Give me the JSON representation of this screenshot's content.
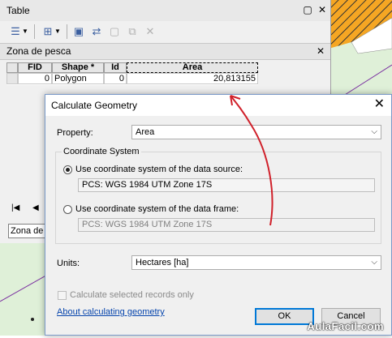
{
  "table_window": {
    "title": "Table",
    "min_glyph": "▢",
    "close_glyph": "✕",
    "layer_tab": "Zona de pesca",
    "layer_close_glyph": "✕",
    "bottom_tab": "Zona de pesca",
    "columns": [
      "FID",
      "Shape *",
      "Id",
      "Area"
    ],
    "row": {
      "fid": "0",
      "shape": "Polygon",
      "id": "0",
      "area": "20,813155"
    },
    "nav_first": "|◀",
    "nav_prev": "◀"
  },
  "dialog": {
    "title": "Calculate Geometry",
    "close_glyph": "✕",
    "property_label": "Property:",
    "property_value": "Area",
    "coord_group_label": "Coordinate System",
    "radio1_label": "Use coordinate system of the data source:",
    "radio1_value": "PCS: WGS 1984 UTM Zone 17S",
    "radio2_label": "Use coordinate system of the data frame:",
    "radio2_value": "PCS: WGS 1984 UTM Zone 17S",
    "units_label": "Units:",
    "units_value": "Hectares [ha]",
    "checkbox_label": "Calculate selected records only",
    "link_text": "About calculating geometry",
    "ok_label": "OK",
    "cancel_label": "Cancel",
    "dropdown_glyph": "⌵"
  },
  "watermark": "AulaFacil.com",
  "colors": {
    "map_green": "#dff0d8",
    "hatch_orange": "#f5a623",
    "annotation_red": "#d0202a"
  }
}
